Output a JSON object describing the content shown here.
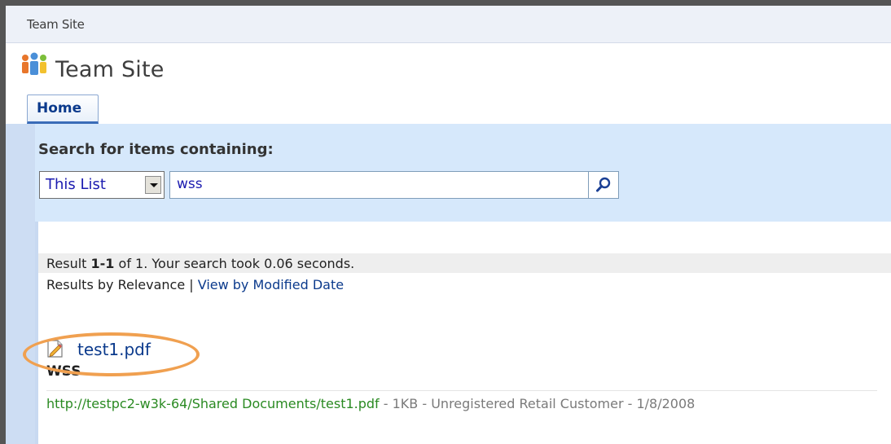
{
  "breadcrumb": "Team Site",
  "site": {
    "title": "Team Site",
    "logo_icon": "people-group-icon"
  },
  "nav": {
    "tabs": [
      {
        "label": "Home",
        "active": true
      }
    ]
  },
  "search": {
    "label": "Search for items containing:",
    "scope_value": "This List",
    "query": "wss",
    "button_icon": "magnifier-icon"
  },
  "results": {
    "summary_pre": "Result ",
    "summary_range": "1-1",
    "summary_post": " of 1. Your search took 0.06 seconds.",
    "sort_current": "Results by Relevance",
    "sort_separator": " | ",
    "sort_link": "View by Modified Date",
    "items": [
      {
        "icon": "pdf-document-icon",
        "title": "test1.pdf",
        "snippet": "WSS",
        "url": "http://testpc2-w3k-64/Shared Documents/test1.pdf",
        "info": " - 1KB - Unregistered Retail Customer - 1/8/2008"
      }
    ]
  },
  "colors": {
    "accent": "#0b3a8c",
    "search_band": "#d6e8fb",
    "url_green": "#2a8a22",
    "highlight": "#f0a050"
  }
}
